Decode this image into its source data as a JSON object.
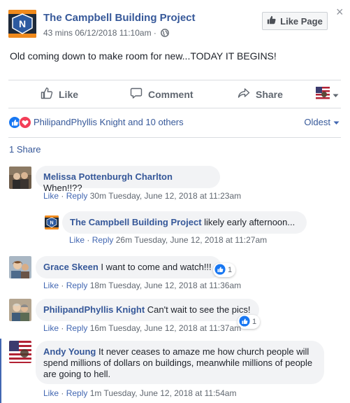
{
  "post": {
    "page_name": "The Campbell Building Project",
    "time": "43 mins",
    "date": "06/12/2018 11:10am",
    "separator": "·",
    "like_page_label": "Like Page",
    "close_glyph": "×",
    "text": "Old coming down to make room for new...TODAY IT BEGINS!"
  },
  "actions": {
    "like_label": "Like",
    "comment_label": "Comment",
    "share_label": "Share"
  },
  "reactions": {
    "summary": "PhilipandPhyllis Knight and 10 others",
    "sort_label": "Oldest"
  },
  "shares": "1 Share",
  "comments": [
    {
      "author": "Melissa Pottenburgh Charlton",
      "text": "When!!??",
      "like": "Like",
      "reply": "Reply",
      "dot": "·",
      "time": "30m",
      "timestamp": "Tuesday, June 12, 2018 at 11:23am"
    },
    {
      "author": "The Campbell Building Project",
      "text": "likely early afternoon...",
      "like": "Like",
      "reply": "Reply",
      "dot": "·",
      "time": "26m",
      "timestamp": "Tuesday, June 12, 2018 at 11:27am"
    },
    {
      "author": "Grace Skeen",
      "text": "I want to come and watch!!!",
      "like": "Like",
      "reply": "Reply",
      "dot": "·",
      "time": "18m",
      "timestamp": "Tuesday, June 12, 2018 at 11:36am",
      "reaction_count": "1"
    },
    {
      "author": "PhilipandPhyllis Knight",
      "text": "Can't wait to see the pics!",
      "like": "Like",
      "reply": "Reply",
      "dot": "·",
      "time": "16m",
      "timestamp": "Tuesday, June 12, 2018 at 11:37am",
      "reaction_count": "1"
    },
    {
      "author": "Andy Young",
      "text": "It never ceases to amaze me how church people will spend millions of dollars on buildings, meanwhile millions of people are going to hell.",
      "like": "Like",
      "reply": "Reply",
      "dot": "·",
      "time": "1m",
      "timestamp": "Tuesday, June 12, 2018 at 11:54am"
    }
  ],
  "colors": {
    "link": "#365899",
    "action_link": "#4267b2",
    "meta": "#606770",
    "bubble": "#f2f3f5",
    "like_blue": "#1877f2",
    "love_red": "#f33e58"
  },
  "icons": {
    "page_avatar": "page-logo-icon",
    "globe": "globe-icon",
    "like": "thumbs-up-icon",
    "comment": "speech-bubble-icon",
    "share": "share-arrow-icon",
    "flag": "us-flag-icon",
    "love": "heart-icon"
  }
}
